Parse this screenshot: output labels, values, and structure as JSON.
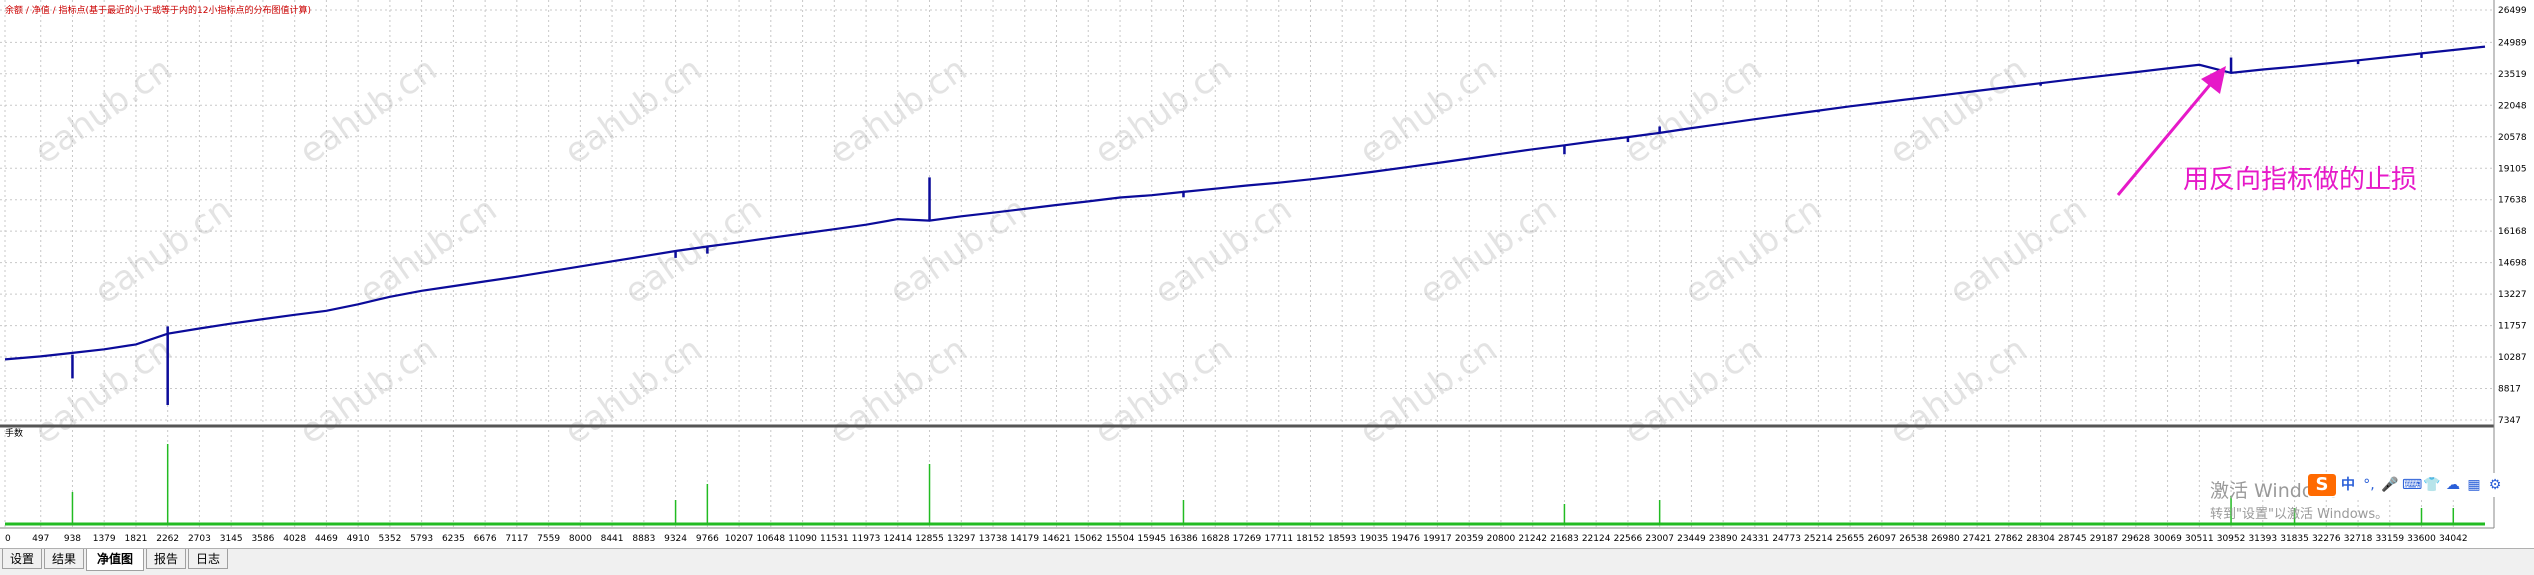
{
  "header": {
    "legend_text": "余额 / 净值 / 指标点(基于最近的小于或等于内的12小指标点的分布图值计算)"
  },
  "annotation": {
    "text": "用反向指标做的止损",
    "color": "#e619c8"
  },
  "lower_panel": {
    "label": "手数"
  },
  "watermark": {
    "text": "eahub.cn"
  },
  "windows_activation": {
    "line1": "激活 Windows",
    "line2": "转到\"设置\"以激活 Windows。"
  },
  "ime_toolbar": {
    "logo": "S",
    "mode": "中",
    "icons": [
      "punctuation-icon",
      "microphone-icon",
      "keyboard-icon",
      "skin-icon",
      "cloud-icon",
      "grid-icon",
      "gear-icon"
    ]
  },
  "tabs": [
    {
      "label": "设置",
      "active": false
    },
    {
      "label": "结果",
      "active": false
    },
    {
      "label": "净值图",
      "active": true
    },
    {
      "label": "报告",
      "active": false
    },
    {
      "label": "日志",
      "active": false
    }
  ],
  "colors": {
    "balance_line": "#0b0b9a",
    "volume_bars": "#22bb22",
    "grid": "#c8c8c8",
    "watermark": "#b0b0b0"
  },
  "chart_data": {
    "type": "line",
    "series": [
      {
        "name": "余额",
        "x": [
          0,
          497,
          938,
          1379,
          1821,
          2262,
          2703,
          3145,
          3586,
          4028,
          4469,
          4910,
          5352,
          5793,
          6235,
          6676,
          7117,
          7559,
          8000,
          8441,
          8883,
          9324,
          9766,
          10207,
          10648,
          11090,
          11531,
          11973,
          12414,
          12855,
          13297,
          13738,
          14179,
          14621,
          15062,
          15504,
          15945,
          16386,
          16828,
          17269,
          17711,
          18152,
          18593,
          19035,
          19476,
          19917,
          20359,
          20800,
          21242,
          21683,
          22124,
          22566,
          23007,
          23449,
          23890,
          24331,
          24773,
          25214,
          25655,
          26097,
          26538,
          26980,
          27421,
          27862,
          28304,
          28745,
          29187,
          29628,
          30069,
          30511,
          30952,
          31393,
          31835,
          32276,
          32718,
          33159,
          33600,
          34042,
          34483
        ],
        "values": [
          10180,
          10320,
          10480,
          10650,
          10880,
          11380,
          11620,
          11850,
          12060,
          12260,
          12450,
          12750,
          13100,
          13380,
          13600,
          13820,
          14040,
          14280,
          14520,
          14760,
          15000,
          15240,
          15450,
          15650,
          15860,
          16060,
          16260,
          16470,
          16730,
          16660,
          16860,
          17030,
          17210,
          17390,
          17560,
          17740,
          17850,
          18000,
          18150,
          18300,
          18430,
          18590,
          18760,
          18950,
          19150,
          19350,
          19560,
          19780,
          19990,
          20180,
          20380,
          20560,
          20760,
          20980,
          21190,
          21400,
          21600,
          21800,
          22000,
          22180,
          22360,
          22540,
          22720,
          22900,
          23080,
          23260,
          23430,
          23600,
          23770,
          23940,
          23560,
          23720,
          23850,
          24000,
          24150,
          24310,
          24470,
          24630,
          24790
        ]
      }
    ],
    "spikes": [
      {
        "x": 938,
        "low": 9290,
        "high": 10400
      },
      {
        "x": 2262,
        "low": 8050,
        "high": 11720
      },
      {
        "x": 9324,
        "low": 14920,
        "high": 15240
      },
      {
        "x": 9766,
        "low": 15120,
        "high": 15460
      },
      {
        "x": 12855,
        "low": 16660,
        "high": 18680
      },
      {
        "x": 16386,
        "low": 17750,
        "high": 18000
      },
      {
        "x": 21683,
        "low": 19760,
        "high": 20180
      },
      {
        "x": 22566,
        "low": 20330,
        "high": 20560
      },
      {
        "x": 23007,
        "low": 20760,
        "high": 21060
      },
      {
        "x": 25214,
        "low": 21720,
        "high": 21800
      },
      {
        "x": 28304,
        "low": 22960,
        "high": 23080
      },
      {
        "x": 30952,
        "low": 23560,
        "high": 24280
      },
      {
        "x": 32718,
        "low": 23970,
        "high": 24150
      },
      {
        "x": 33600,
        "low": 24260,
        "high": 24470
      }
    ],
    "ylim": [
      7347,
      26499
    ],
    "xlim": [
      0,
      34483
    ],
    "yticks": [
      26499,
      24989,
      23519,
      22048,
      20578,
      19105,
      17638,
      16168,
      14698,
      13227,
      11757,
      10287,
      8817,
      7347
    ],
    "xticks": [
      0,
      497,
      938,
      1379,
      1821,
      2262,
      2703,
      3145,
      3586,
      4028,
      4469,
      4910,
      5352,
      5793,
      6235,
      6676,
      7117,
      7559,
      8000,
      8441,
      8883,
      9324,
      9766,
      10207,
      10648,
      11090,
      11531,
      11973,
      12414,
      12855,
      13297,
      13738,
      14179,
      14621,
      15062,
      15504,
      15945,
      16386,
      16828,
      17269,
      17711,
      18152,
      18593,
      19035,
      19476,
      19917,
      20359,
      20800,
      21242,
      21683,
      22124,
      22566,
      23007,
      23449,
      23890,
      24331,
      24773,
      25214,
      25655,
      26097,
      26538,
      26980,
      27421,
      27862,
      28304,
      28745,
      29187,
      29628,
      30069,
      30511,
      30952,
      31393,
      31835,
      32276,
      32718,
      33159,
      33600,
      34042
    ],
    "grid": true,
    "volume": {
      "x": [
        938,
        2262,
        9324,
        9766,
        12855,
        16386,
        21683,
        23007,
        30952,
        31835,
        33600,
        34042
      ],
      "values": [
        0.4,
        1.0,
        0.3,
        0.5,
        0.75,
        0.3,
        0.25,
        0.3,
        0.35,
        0.2,
        0.2,
        0.2
      ]
    }
  }
}
